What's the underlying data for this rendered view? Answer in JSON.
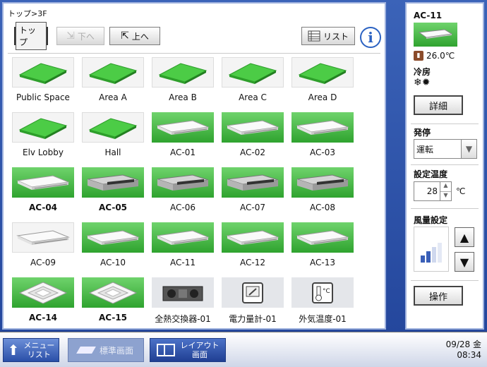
{
  "breadcrumb": "トップ>3F",
  "toolbar": {
    "top_label": "トップ",
    "down_label": "下へ",
    "up_label": "上へ",
    "list_label": "リスト",
    "info_label": "i"
  },
  "tiles": [
    {
      "label": "Public Space"
    },
    {
      "label": "Area A"
    },
    {
      "label": "Area B"
    },
    {
      "label": "Area C"
    },
    {
      "label": "Area D"
    },
    {
      "label": "Elv Lobby"
    },
    {
      "label": "Hall"
    },
    {
      "label": "AC-01"
    },
    {
      "label": "AC-02"
    },
    {
      "label": "AC-03"
    },
    {
      "label": "AC-04"
    },
    {
      "label": "AC-05"
    },
    {
      "label": "AC-06"
    },
    {
      "label": "AC-07"
    },
    {
      "label": "AC-08"
    },
    {
      "label": "AC-09"
    },
    {
      "label": "AC-10"
    },
    {
      "label": "AC-11"
    },
    {
      "label": "AC-12"
    },
    {
      "label": "AC-13"
    },
    {
      "label": "AC-14"
    },
    {
      "label": "AC-15"
    },
    {
      "label": "全熱交換器-01"
    },
    {
      "label": "電力量計-01"
    },
    {
      "label": "外気温度-01"
    }
  ],
  "side": {
    "unit_name": "AC-11",
    "temperature": "26.0℃",
    "mode": "冷房",
    "detail_label": "詳細",
    "onoff_title": "発停",
    "onoff_value": "運転",
    "setpoint_title": "設定温度",
    "setpoint_value": "28",
    "setpoint_unit": "℃",
    "fan_title": "風量設定",
    "operate_label": "操作"
  },
  "bottom": {
    "menu_label_1": "メニュー",
    "menu_label_2": "リスト",
    "standard_label": "標準画面",
    "layout_label_1": "レイアウト",
    "layout_label_2": "画面",
    "date": "09/28 金",
    "time": "08:34"
  }
}
